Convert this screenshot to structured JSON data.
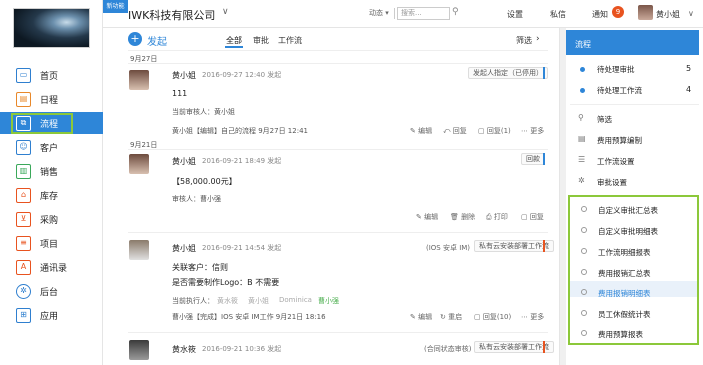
{
  "header": {
    "new_badge": "新功能",
    "company": "IWK科技有限公司",
    "dynamic_label": "动态",
    "search_placeholder": "搜索...",
    "settings": "设置",
    "messages": "私信",
    "notifications": "通知",
    "notif_count": "9",
    "user": "黄小姐"
  },
  "sidebar": {
    "items": [
      {
        "label": "首页",
        "icon": "monitor-icon"
      },
      {
        "label": "日程",
        "icon": "calendar-icon"
      },
      {
        "label": "流程",
        "icon": "workflow-icon"
      },
      {
        "label": "客户",
        "icon": "customer-icon"
      },
      {
        "label": "销售",
        "icon": "sales-icon"
      },
      {
        "label": "库存",
        "icon": "warehouse-icon"
      },
      {
        "label": "采购",
        "icon": "cart-icon"
      },
      {
        "label": "项目",
        "icon": "project-icon"
      },
      {
        "label": "通讯录",
        "icon": "contacts-icon"
      },
      {
        "label": "后台",
        "icon": "gear-icon"
      },
      {
        "label": "应用",
        "icon": "apps-icon"
      }
    ]
  },
  "feed": {
    "new_label": "发起",
    "tabs": [
      "全部",
      "审批",
      "工作流"
    ],
    "filter": "筛选",
    "posts": [
      {
        "date": "9月27日",
        "name": "黄小姐",
        "time": "2016-09-27 12:40 发起",
        "tag": "发起人指定（已停用）",
        "body": "111",
        "approver": "当前审核人：黄小姐",
        "meta": "黄小姐【编辑】自己的流程  9月27日 12:41",
        "actions": [
          "编辑",
          "回复",
          "回复(1)",
          "更多"
        ]
      },
      {
        "date": "9月21日",
        "name": "黄小姐",
        "time": "2016-09-21 18:49 发起",
        "tag": "回款",
        "body": "【58,000.00元】",
        "approver": "审核人：曹小强",
        "actions": [
          "编辑",
          "删除",
          "打印",
          "回复"
        ]
      },
      {
        "name": "黄小姐",
        "time": "2016-09-21 14:54 发起",
        "source": "(IOS 安卓 IM)",
        "tag": "私有云安装部署工作流",
        "body1": "关联客户：信则",
        "body2": "是否需要制作Logo：B 不需要",
        "executors_label": "当前执行人：",
        "executors": [
          "黄水筱",
          "黄小姐",
          "Dominica",
          "曹小强"
        ],
        "meta": "曹小强【完成】IOS 安卓 IM工作  9月21日 18:16",
        "actions": [
          "编辑",
          "重启",
          "回复(10)",
          "更多"
        ]
      },
      {
        "name": "黄水筱",
        "time": "2016-09-21 10:36 发起",
        "source": "(合同状态审核)",
        "tag": "私有云安装部署工作流"
      }
    ]
  },
  "right_panel": {
    "title": "流程",
    "pending": [
      {
        "label": "待处理审批",
        "count": "5"
      },
      {
        "label": "待处理工作流",
        "count": "4"
      }
    ],
    "menu": [
      {
        "label": "筛选",
        "icon": "search-icon"
      },
      {
        "label": "费用预算编制",
        "icon": "document-icon"
      },
      {
        "label": "工作流设置",
        "icon": "list-icon"
      },
      {
        "label": "审批设置",
        "icon": "gear-icon"
      }
    ],
    "reports": [
      "自定义审批汇总表",
      "自定义审批明细表",
      "工作流明细报表",
      "费用报销汇总表",
      "费用报销明细表",
      "员工休假统计表",
      "费用预算报表"
    ],
    "highlighted_report": "费用报销明细表"
  },
  "colors": {
    "accent": "#2e86d8",
    "highlight_border": "#8cc83a",
    "badge": "#e8531f"
  }
}
